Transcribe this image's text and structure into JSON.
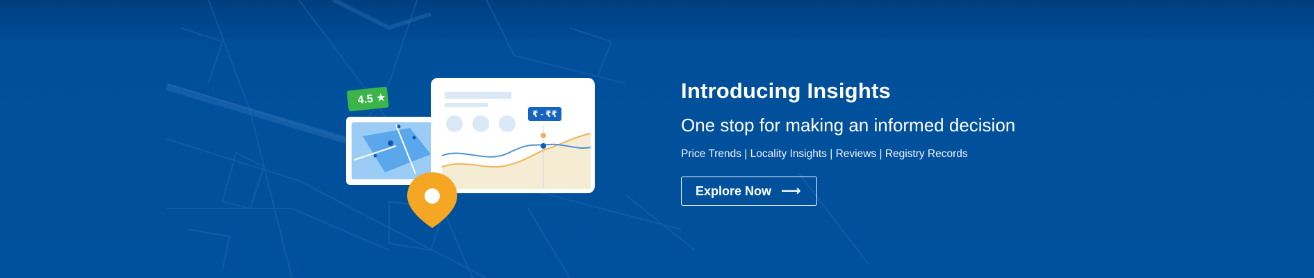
{
  "banner": {
    "title": "Introducing Insights",
    "subtitle": "One stop for making an informed decision",
    "tags": "Price Trends | Locality Insights | Reviews | Registry Records",
    "cta_label": "Explore Now",
    "cta_icon": "arrow-right-icon",
    "rating": "4.5",
    "rating_icon": "star-icon",
    "price_tag": "₹ - ₹₹"
  },
  "colors": {
    "background": "#00519d",
    "rating_badge": "#3bb54a",
    "pin": "#f5a623",
    "price_tag": "#1565c0",
    "text": "#ffffff"
  }
}
